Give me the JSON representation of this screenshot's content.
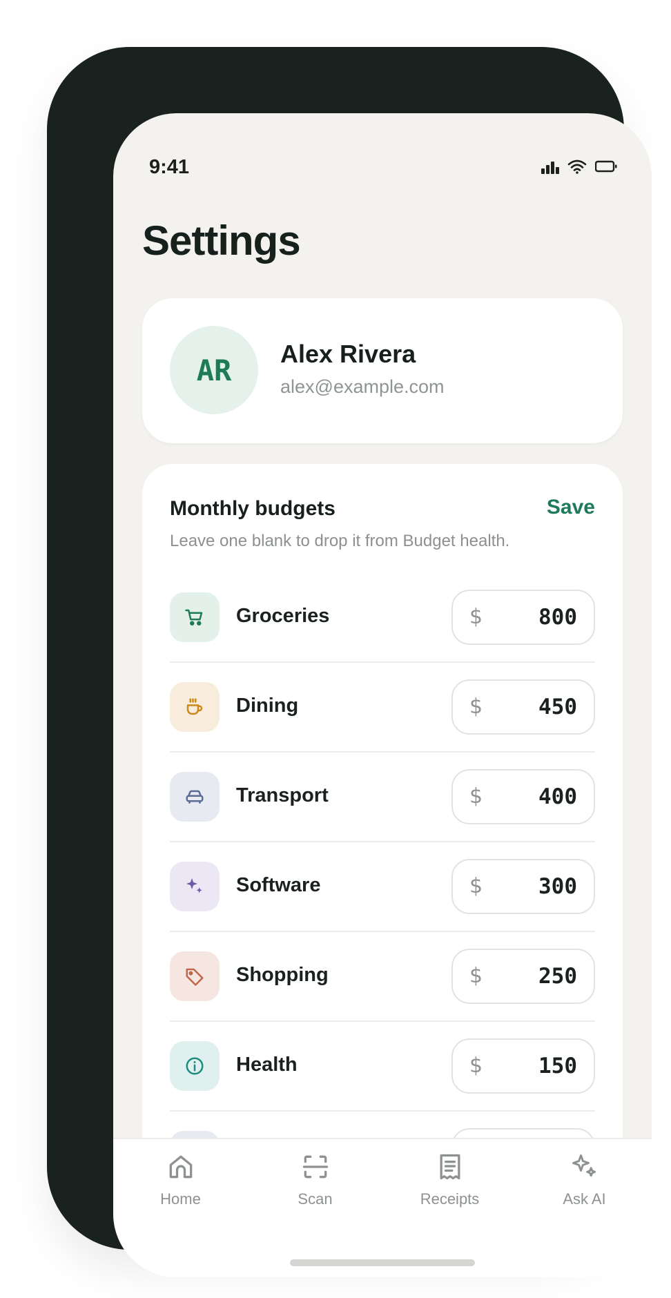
{
  "status": {
    "time": "9:41"
  },
  "page": {
    "title": "Settings"
  },
  "profile": {
    "initials": "AR",
    "name": "Alex Rivera",
    "email": "alex@example.com"
  },
  "budgets": {
    "title": "Monthly budgets",
    "save_label": "Save",
    "subtitle": "Leave one blank to drop it from Budget health.",
    "currency": "$",
    "items": [
      {
        "label": "Groceries",
        "value": "800",
        "icon": "cart-icon",
        "color": "#1f7a5a",
        "bg": "#e3f1ea"
      },
      {
        "label": "Dining",
        "value": "450",
        "icon": "coffee-icon",
        "color": "#c98a1b",
        "bg": "#f8ecdc"
      },
      {
        "label": "Transport",
        "value": "400",
        "icon": "car-icon",
        "color": "#5a6b94",
        "bg": "#e8eaf2"
      },
      {
        "label": "Software",
        "value": "300",
        "icon": "sparkle-icon",
        "color": "#6b5aa8",
        "bg": "#ebe7f4"
      },
      {
        "label": "Shopping",
        "value": "250",
        "icon": "tag-icon",
        "color": "#c0664a",
        "bg": "#f6e6e1"
      },
      {
        "label": "Health",
        "value": "150",
        "icon": "info-icon",
        "color": "#1f8a80",
        "bg": "#e0f0ee"
      },
      {
        "label": "",
        "value": "",
        "icon": "category-icon",
        "color": "#5a6b94",
        "bg": "#e8eaf2"
      }
    ]
  },
  "tabs": [
    {
      "label": "Home",
      "icon": "home-icon"
    },
    {
      "label": "Scan",
      "icon": "scan-icon"
    },
    {
      "label": "Receipts",
      "icon": "receipt-icon"
    },
    {
      "label": "Ask AI",
      "icon": "sparkle-icon"
    }
  ],
  "colors": {
    "accent": "#1f7a5a",
    "frame": "#19221f",
    "background": "#f3f2ee"
  }
}
